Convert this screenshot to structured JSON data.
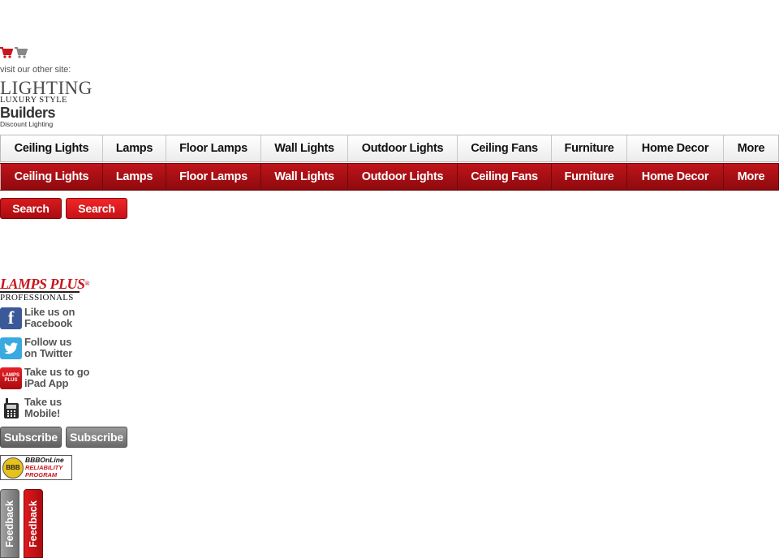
{
  "header": {
    "cart_icons": [
      "cart-icon-red",
      "cart-icon-gray"
    ],
    "visit_label": "visit our other site:",
    "luxury": {
      "line1": "LIGHTING",
      "line2": "LUXURY STYLE"
    },
    "builders": {
      "line1": "Builders",
      "line2": "Discount Lighting"
    }
  },
  "nav": {
    "items": [
      "Ceiling Lights",
      "Lamps",
      "Floor Lamps",
      "Wall Lights",
      "Outdoor Lights",
      "Ceiling Fans",
      "Furniture",
      "Home Decor",
      "More"
    ]
  },
  "search": {
    "button1": "Search",
    "button2": "Search"
  },
  "footer": {
    "lamps_plus": {
      "line1": "LAMPS PLUS",
      "line2": "PROFESSIONALS",
      "reg": "®"
    },
    "facebook": {
      "line1": "Like us on",
      "line2": "Facebook",
      "icon": "facebook-icon"
    },
    "twitter": {
      "line1": "Follow us",
      "line2": "on Twitter",
      "icon": "twitter-icon"
    },
    "ipad": {
      "line1": "Take us to go",
      "line2": "iPad App",
      "icon": "ipad-app-icon",
      "icon_text": "LAMPS PLUS"
    },
    "mobile": {
      "line1": "Take us",
      "line2": "Mobile!",
      "icon": "phone-icon"
    },
    "subscribe1": "Subscribe",
    "subscribe2": "Subscribe",
    "bbb": {
      "line1": "BBBOnLine",
      "line2": "RELIABILITY",
      "line3": "PROGRAM",
      "seal": "BBB"
    },
    "feedback1": "Feedback",
    "feedback2": "Feedback"
  },
  "colors": {
    "brand_red": "#c8161c",
    "dark_red": "#8e0a0e",
    "facebook_blue": "#3b5998",
    "twitter_blue": "#39a9e0",
    "gray": "#6f6f6f"
  }
}
